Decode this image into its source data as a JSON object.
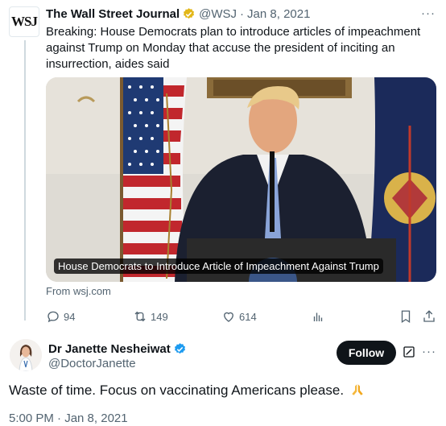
{
  "colors": {
    "accent": "#1d9bf0",
    "text": "#0f1419",
    "muted": "#536471",
    "gold": "#e2b719"
  },
  "quoted_tweet": {
    "avatar_text": "WSJ",
    "name": "The Wall Street Journal",
    "handle": "@WSJ",
    "separator": "·",
    "date": "Jan 8, 2021",
    "more": "···",
    "text": "Breaking: House Democrats plan to introduce articles of impeachment against Trump on Monday that accuse the president of inciting an insurrection, aides said",
    "card_caption": "House Democrats to Introduce Article of Impeachment Against Trump",
    "source": "From wsj.com",
    "actions": {
      "replies": "94",
      "retweets": "149",
      "likes": "614"
    }
  },
  "reply": {
    "name": "Dr Janette Nesheiwat",
    "handle": "@DoctorJanette",
    "follow_label": "Follow",
    "more": "···",
    "text": "Waste of time. Focus on vaccinating Americans please.",
    "timestamp": "5:00 PM · Jan 8, 2021"
  },
  "icons": [
    "verified-gold-badge-icon",
    "verified-blue-badge-icon",
    "reply-icon",
    "retweet-icon",
    "like-icon",
    "views-icon",
    "bookmark-icon",
    "share-icon",
    "grok-icon",
    "more-icon",
    "praying-hands-icon"
  ]
}
